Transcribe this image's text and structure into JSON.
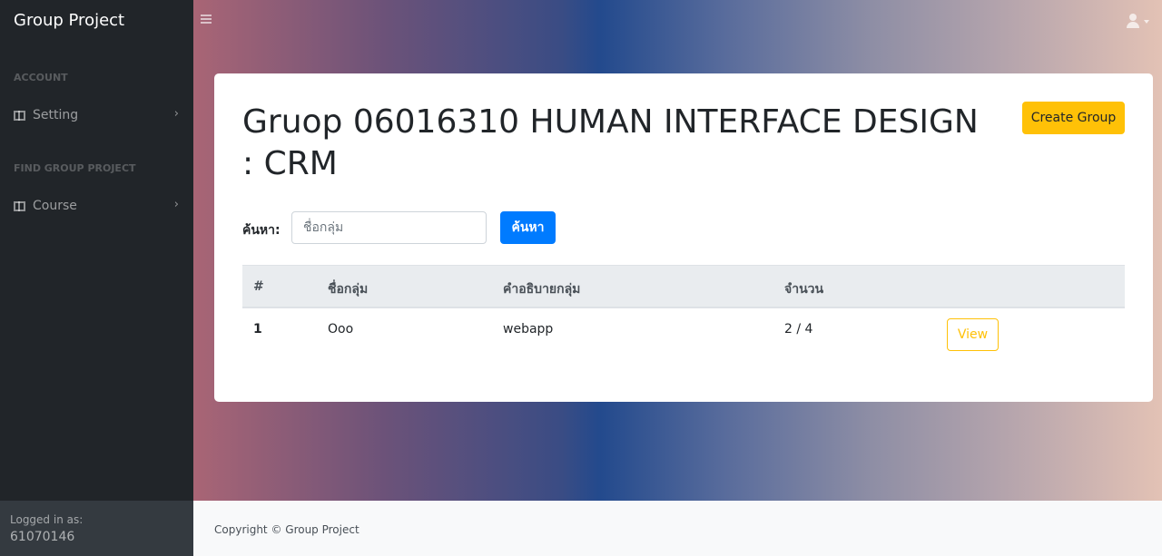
{
  "sidebar": {
    "brand": "Group Project",
    "sections": [
      {
        "heading": "ACCOUNT",
        "item": {
          "label": "Setting",
          "icon": "columns-icon"
        }
      },
      {
        "heading": "FIND GROUP PROJECT",
        "item": {
          "label": "Course",
          "icon": "columns-icon"
        }
      }
    ],
    "footer": {
      "label": "Logged in as:",
      "user": "61070146"
    }
  },
  "header": {
    "menu_icon": "bars-icon",
    "user_icon": "user-icon"
  },
  "main": {
    "title": "Gruop 06016310 HUMAN INTERFACE DESIGN : CRM",
    "create_button": "Create Group",
    "search": {
      "label": "ค้นหา:",
      "placeholder": "ชื่อกลุ่ม",
      "value": "",
      "button": "ค้นหา"
    },
    "table": {
      "columns": [
        "#",
        "ชื่อกลุ่ม",
        "คำอธิบายกลุ่ม",
        "จำนวน",
        ""
      ],
      "rows": [
        {
          "num": "1",
          "name": "Ooo",
          "desc": "webapp",
          "count": "2 / 4",
          "action": "View"
        }
      ]
    }
  },
  "footer": {
    "copyright": "Copyright © Group Project"
  },
  "colors": {
    "sidebar": "#212529",
    "accent_warning": "#ffc107",
    "accent_primary": "#007bff"
  }
}
